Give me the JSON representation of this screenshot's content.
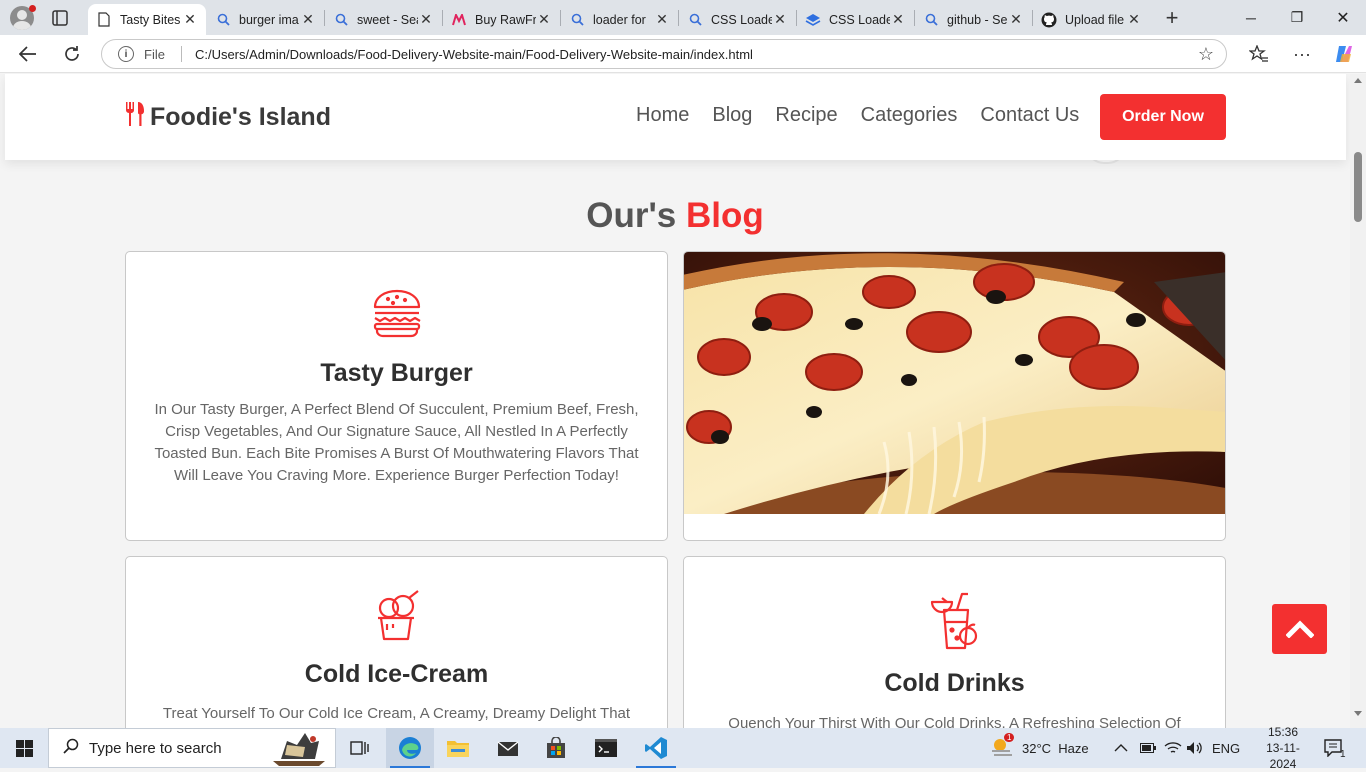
{
  "browser": {
    "tabs": [
      {
        "title": "Tasty Bites",
        "icon": "page-icon",
        "active": true
      },
      {
        "title": "burger ima",
        "icon": "search-icon"
      },
      {
        "title": "sweet - Sea",
        "icon": "search-icon"
      },
      {
        "title": "Buy RawFr",
        "icon": "brand-m-icon"
      },
      {
        "title": "loader for",
        "icon": "search-icon"
      },
      {
        "title": "CSS Loade",
        "icon": "search-icon"
      },
      {
        "title": "CSS Loade",
        "icon": "layers-icon"
      },
      {
        "title": "github - Se",
        "icon": "search-icon"
      },
      {
        "title": "Upload file",
        "icon": "github-icon"
      }
    ],
    "address": {
      "scheme_label": "File",
      "url": "C:/Users/Admin/Downloads/Food-Delivery-Website-main/Food-Delivery-Website-main/index.html"
    }
  },
  "site": {
    "brand": "Foodie's Island",
    "nav": [
      "Home",
      "Blog",
      "Recipe",
      "Categories",
      "Contact Us"
    ],
    "cta": "Order Now",
    "section_title_main": "Our's",
    "section_title_accent": "Blog",
    "cards": [
      {
        "title": "Tasty Burger",
        "icon": "burger-icon",
        "text": "In Our Tasty Burger, A Perfect Blend Of Succulent, Premium Beef, Fresh, Crisp Vegetables, And Our Signature Sauce, All Nestled In A Perfectly Toasted Bun. Each Bite Promises A Burst Of Mouthwatering Flavors That Will Leave You Craving More. Experience Burger Perfection Today!"
      },
      {
        "title": "Cold Ice-Cream",
        "icon": "ice-cream-icon",
        "text": "Treat Yourself To Our Cold Ice Cream, A Creamy, Dreamy Delight That"
      },
      {
        "title": "Cold Drinks",
        "icon": "drinks-icon",
        "text": "Quench Your Thirst With Our Cold Drinks, A Refreshing Selection Of"
      }
    ],
    "accent_color": "#f33030"
  },
  "taskbar": {
    "search_placeholder": "Type here to search",
    "weather": "32°C  Haze",
    "weather_badge": "1",
    "language": "ENG",
    "time": "15:36",
    "date": "13-11-2024",
    "notification_count": "1"
  }
}
